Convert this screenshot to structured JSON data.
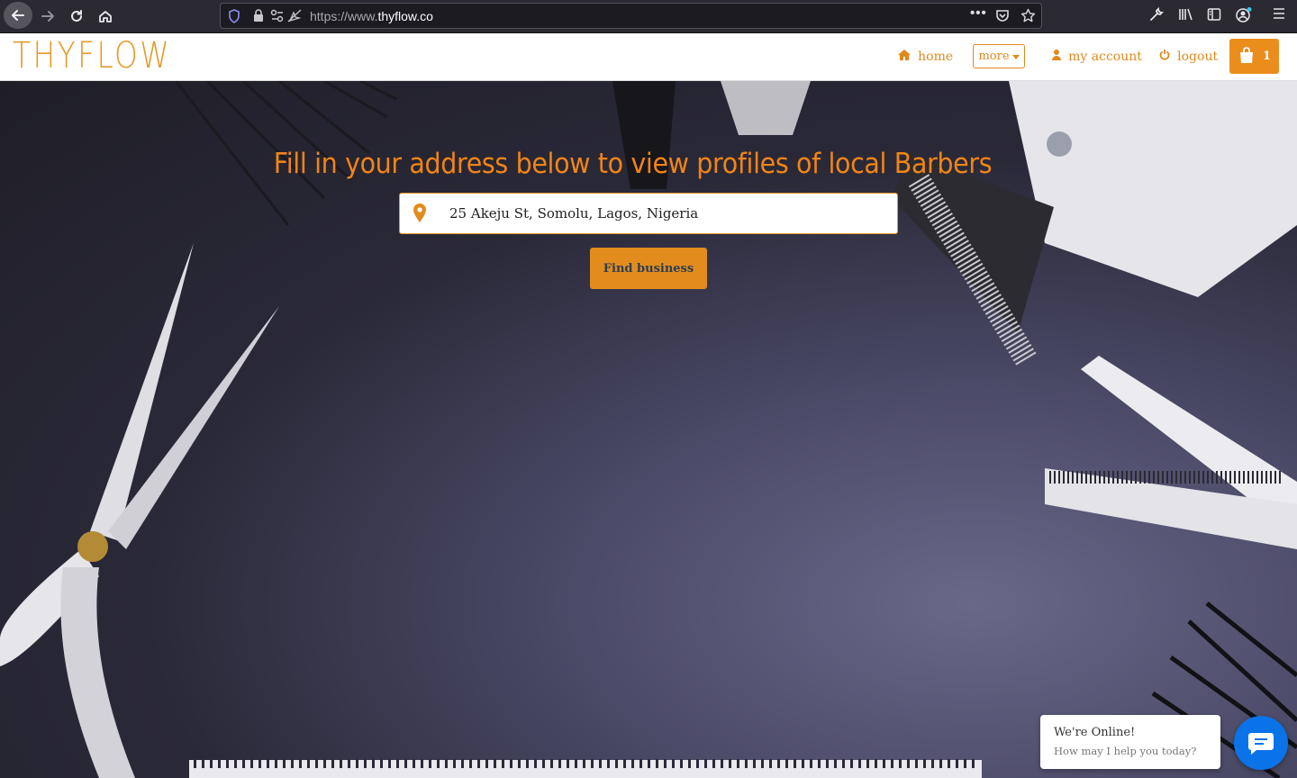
{
  "browser": {
    "url_prefix": "https://www.",
    "url_domain": "thyflow.co",
    "icons": {
      "back": "arrow-left-icon",
      "forward": "arrow-right-icon",
      "reload": "reload-icon",
      "home": "home-icon",
      "shield": "shield-icon",
      "lock": "lock-icon",
      "permissions": "permissions-icon",
      "page-actions": "more-dots-icon",
      "pocket": "pocket-icon",
      "bookmark": "star-icon",
      "tools": "wrench-icon",
      "library": "library-icon",
      "sidebar": "sidebar-icon",
      "account": "account-icon",
      "menu": "hamburger-icon"
    }
  },
  "header": {
    "logo": "THYFLOW",
    "nav": {
      "home": "home",
      "more": "more",
      "my_account": "my account",
      "logout": "logout",
      "cart_count": "1"
    },
    "accent_color": "#e08a1c"
  },
  "hero": {
    "title": "Fill in your address below to view profiles of local Barbers",
    "address_value": "25 Akeju St, Somolu, Lagos, Nigeria",
    "find_button": "Find business",
    "title_color": "#f18418",
    "button_color": "#e38c1e"
  },
  "chat": {
    "status": "We're Online!",
    "prompt": "How may I help you today?",
    "launcher_color": "#0a73e8"
  }
}
